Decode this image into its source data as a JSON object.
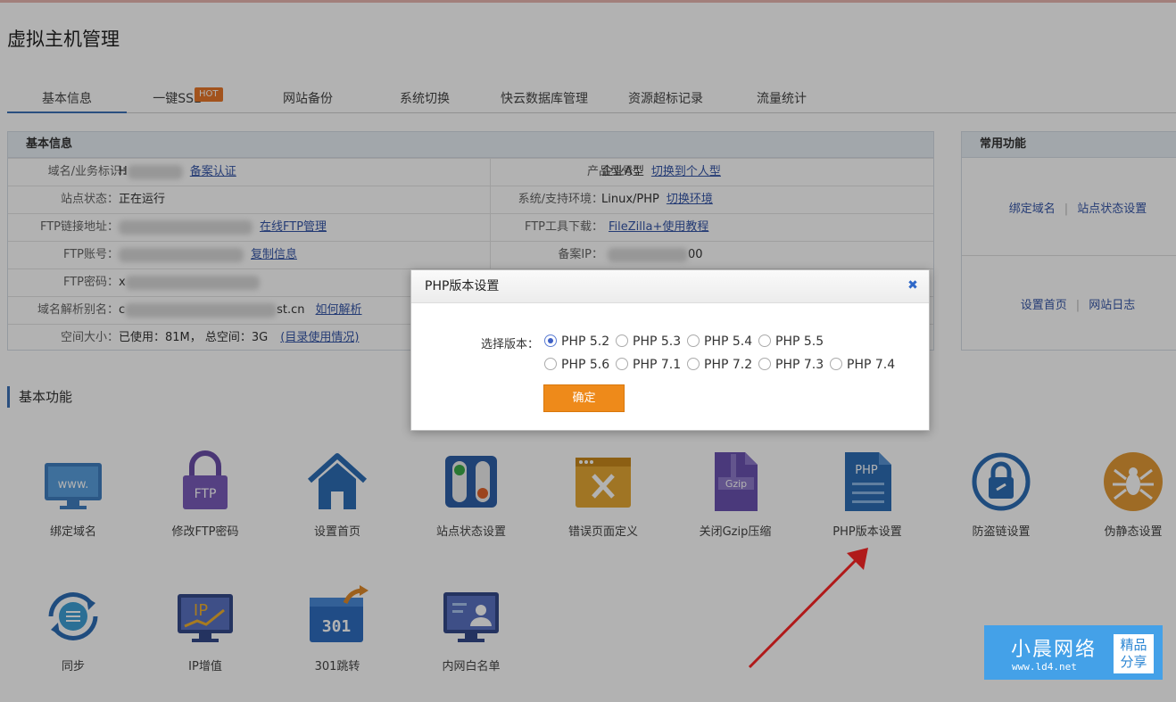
{
  "page_title": "虚拟主机管理",
  "tabs": [
    {
      "label": "基本信息",
      "active": true
    },
    {
      "label": "一键SSL",
      "badge": "HOT"
    },
    {
      "label": "网站备份"
    },
    {
      "label": "系统切换"
    },
    {
      "label": "快云数据库管理"
    },
    {
      "label": "资源超标记录"
    },
    {
      "label": "流量统计"
    }
  ],
  "info": {
    "title": "基本信息",
    "left": [
      {
        "label": "域名/业务标识：",
        "value": "H",
        "link": "备案认证"
      },
      {
        "label": "站点状态：",
        "value": "正在运行"
      },
      {
        "label": "FTP链接地址：",
        "value": "",
        "link": "在线FTP管理"
      },
      {
        "label": "FTP账号：",
        "value": "",
        "link": "复制信息"
      },
      {
        "label": "FTP密码：",
        "value": "x"
      },
      {
        "label": "域名解析别名：",
        "value": "c",
        "value_tail": "st.cn",
        "link": "如何解析"
      },
      {
        "label": "空间大小：",
        "value": "已使用：81M， 总空间：3G",
        "link": "(目录使用情况)"
      }
    ],
    "right": [
      {
        "label": "产品型号：",
        "value": "企业A型",
        "link": "切换到个人型"
      },
      {
        "label": "系统/支持环境：",
        "value": "Linux/PHP",
        "link": "切换环境"
      },
      {
        "label": "FTP工具下载：",
        "value": "",
        "link": "FileZilla+使用教程"
      },
      {
        "label": "备案IP：",
        "value": "00"
      }
    ]
  },
  "common": {
    "title": "常用功能",
    "row1": [
      "绑定域名",
      "站点状态设置"
    ],
    "row2": [
      "设置首页",
      "网站日志"
    ],
    "separator": "|"
  },
  "basic_functions": {
    "title": "基本功能",
    "items": [
      {
        "label": "绑定域名",
        "icon": "www-monitor-icon",
        "text": "www."
      },
      {
        "label": "修改FTP密码",
        "icon": "ftp-lock-icon",
        "text": "FTP"
      },
      {
        "label": "设置首页",
        "icon": "home-icon"
      },
      {
        "label": "站点状态设置",
        "icon": "toggle-switch-icon"
      },
      {
        "label": "错误页面定义",
        "icon": "error-page-icon"
      },
      {
        "label": "关闭Gzip压缩",
        "icon": "gzip-file-icon",
        "text": "Gzip"
      },
      {
        "label": "PHP版本设置",
        "icon": "php-file-icon",
        "text": "PHP"
      },
      {
        "label": "防盗链设置",
        "icon": "anti-hotlink-icon"
      },
      {
        "label": "伪静态设置",
        "icon": "spider-icon"
      },
      {
        "label": "同步",
        "icon": "sync-icon"
      },
      {
        "label": "IP增值",
        "icon": "ip-chart-icon",
        "text": "IP"
      },
      {
        "label": "301跳转",
        "icon": "redirect-301-icon",
        "text": "301"
      },
      {
        "label": "内网白名单",
        "icon": "whitelist-monitor-icon"
      }
    ]
  },
  "dialog": {
    "title": "PHP版本设置",
    "close_glyph": "✖",
    "select_label": "选择版本：",
    "options": [
      "PHP 5.2",
      "PHP 5.3",
      "PHP 5.4",
      "PHP 5.5",
      "PHP 5.6",
      "PHP 7.1",
      "PHP 7.2",
      "PHP 7.3",
      "PHP 7.4"
    ],
    "selected": "PHP 5.2",
    "confirm": "确定"
  },
  "watermark": {
    "title": "小晨网络",
    "url": "www.ld4.net",
    "badge_line1": "精品",
    "badge_line2": "分享"
  },
  "colors": {
    "accent": "#3d71b7",
    "confirm_button": "#ee8a1a",
    "hot_badge": "#e8782a",
    "link": "#3656a8",
    "arrow": "#b01a1a"
  }
}
